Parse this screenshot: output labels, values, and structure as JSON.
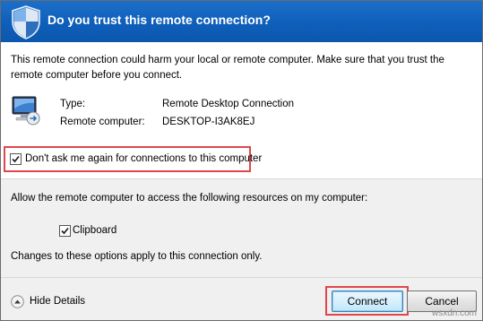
{
  "dialog": {
    "title": "Do you trust this remote connection?",
    "warning_text": "This remote connection could harm your local or remote computer. Make sure that you trust the remote computer before you connect.",
    "icons": {
      "title_icon": "shield-icon",
      "connection_icon": "remote-desktop-icon"
    }
  },
  "connection_info": {
    "type_label": "Type:",
    "type_value": "Remote Desktop Connection",
    "computer_label": "Remote computer:",
    "computer_value": "DESKTOP-I3AK8EJ"
  },
  "dont_ask": {
    "label": "Don't ask me again for connections to this computer",
    "checked": true
  },
  "resources": {
    "heading": "Allow the remote computer to access the following resources on my computer:",
    "clipboard_label": "Clipboard",
    "clipboard_checked": true,
    "note": "Changes to these options apply to this connection only."
  },
  "footer": {
    "details_label": "Hide Details",
    "connect_label": "Connect",
    "cancel_label": "Cancel"
  },
  "watermark": "wsxdn.com",
  "colors": {
    "title_bar": "#0f5fba",
    "highlight": "#e0474c",
    "panel": "#f0f0f0"
  }
}
